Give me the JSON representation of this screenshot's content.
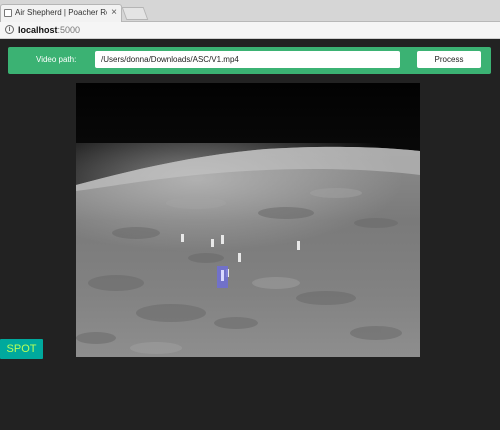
{
  "browser": {
    "tab_title": "Air Shepherd | Poacher Recogn",
    "tab_close": "×",
    "url_host": "localhost",
    "url_port": ":5000",
    "info_icon_glyph": "i"
  },
  "toolbar": {
    "path_label": "Video path:",
    "path_value": "/Users/donna/Downloads/ASC/V1.mp4",
    "process_label": "Process",
    "accent_color": "#3bb273"
  },
  "video": {
    "icon": "thermal-video-frame",
    "detection_count": 1
  },
  "spot_button": {
    "label": "SPOT",
    "background": "#00a99d",
    "text_color": "#b6ff5a"
  }
}
